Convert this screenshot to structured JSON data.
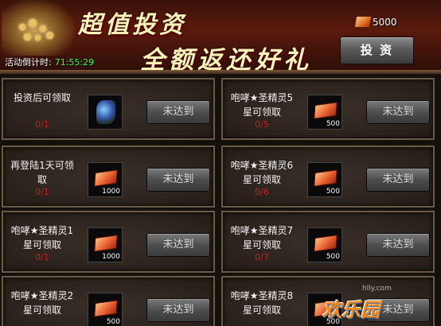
{
  "banner": {
    "title_line1": "超值投资",
    "title_line2": "全额返还好礼",
    "countdown_label": "活动倒计时:",
    "countdown_value": "71:55:29",
    "currency_icon": "gold-ingot-icon",
    "currency_amount": "5000",
    "invest_button": "投 资"
  },
  "rewards": [
    {
      "col": "left",
      "desc": "投资后可领取",
      "progress": "0/1",
      "reward_icon": "scroll-icon",
      "reward_qty": "",
      "status": "未达到"
    },
    {
      "col": "left",
      "desc": "再登陆1天可领取",
      "progress": "0/1",
      "reward_icon": "gold-ingot-icon",
      "reward_qty": "1000",
      "status": "未达到"
    },
    {
      "col": "left",
      "desc": "咆哮★圣精灵1星可领取",
      "progress": "0/1",
      "reward_icon": "gold-ingot-icon",
      "reward_qty": "1000",
      "status": "未达到"
    },
    {
      "col": "left",
      "desc": "咆哮★圣精灵2星可领取",
      "progress": "",
      "reward_icon": "gold-ingot-icon",
      "reward_qty": "500",
      "status": "未达到"
    },
    {
      "col": "right",
      "desc": "咆哮★圣精灵5星可领取",
      "progress": "0/5",
      "reward_icon": "gold-ingot-icon",
      "reward_qty": "500",
      "status": "未达到"
    },
    {
      "col": "right",
      "desc": "咆哮★圣精灵6星可领取",
      "progress": "0/6",
      "reward_icon": "gold-ingot-icon",
      "reward_qty": "500",
      "status": "未达到"
    },
    {
      "col": "right",
      "desc": "咆哮★圣精灵7星可领取",
      "progress": "0/7",
      "reward_icon": "gold-ingot-icon",
      "reward_qty": "500",
      "status": "未达到"
    },
    {
      "col": "right",
      "desc": "咆哮★圣精灵8星可领取",
      "progress": "",
      "reward_icon": "gold-ingot-icon",
      "reward_qty": "500",
      "status": "未达到"
    }
  ],
  "watermark": {
    "site": "hlly.com",
    "text": "欢乐园"
  },
  "colors": {
    "progress": "#c81e1e",
    "countdown": "#33ff33",
    "title": "#fff3b8"
  }
}
